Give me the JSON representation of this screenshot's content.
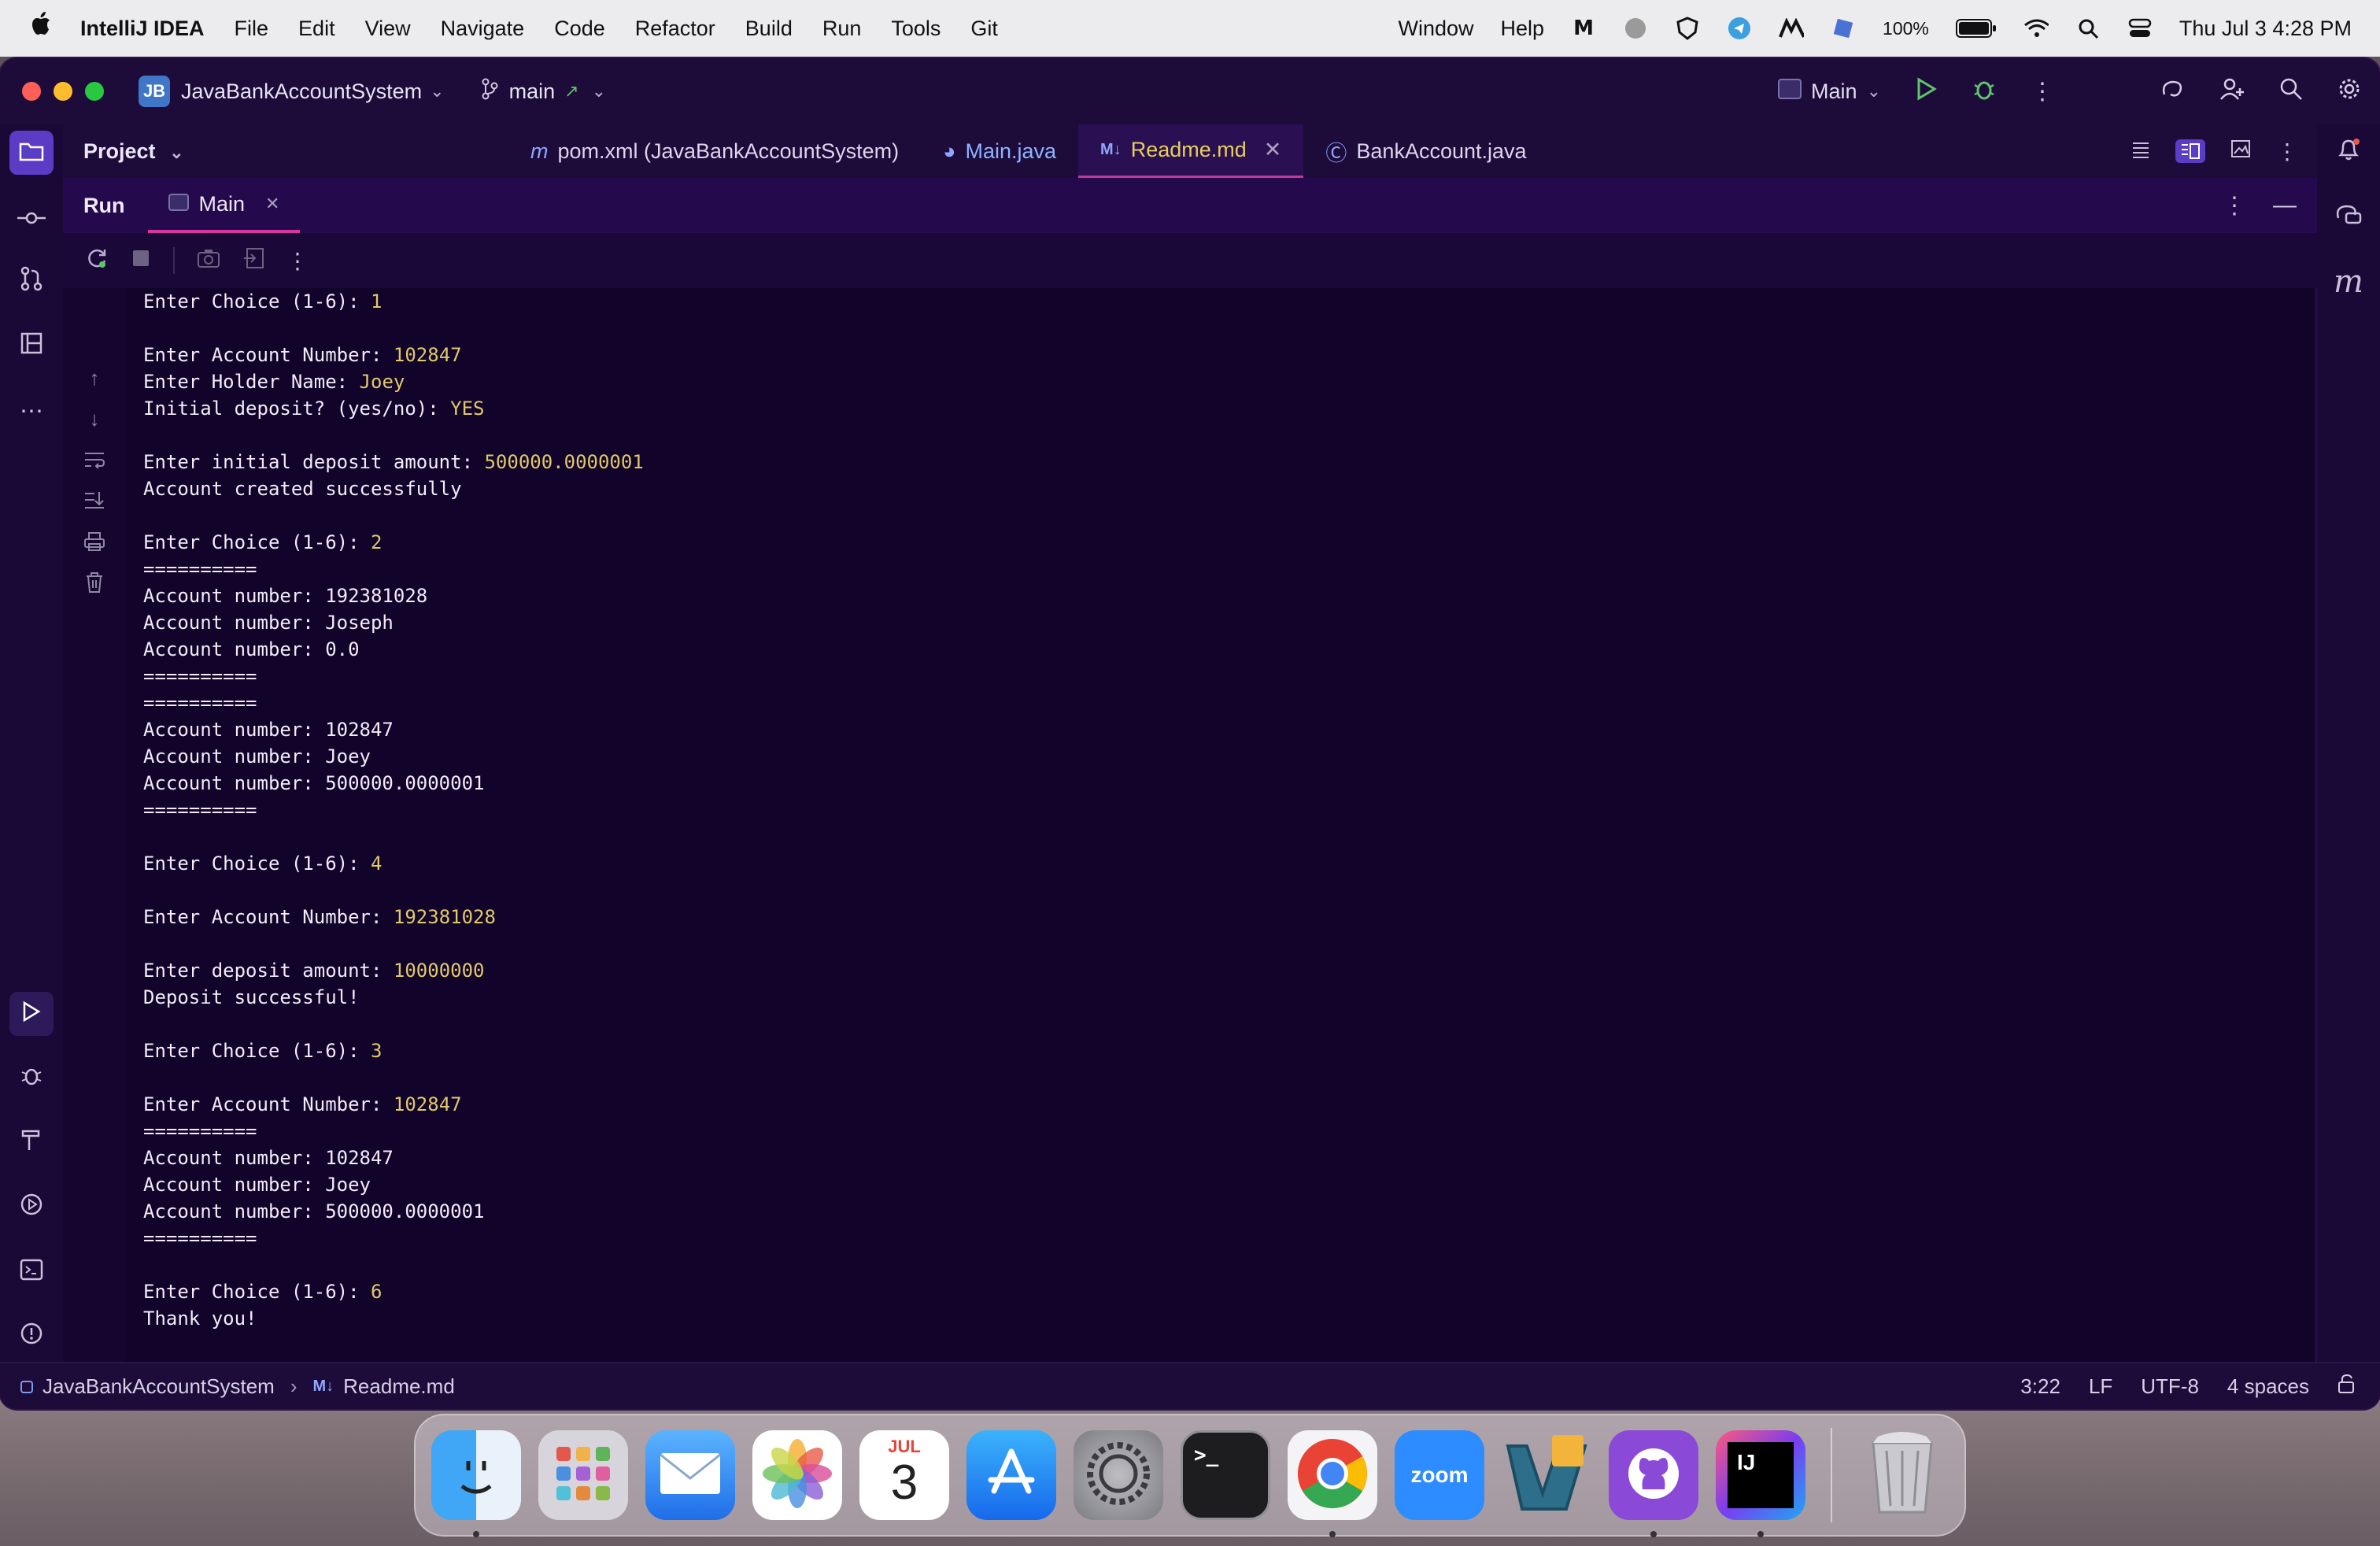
{
  "menubar": {
    "app_name": "IntelliJ IDEA",
    "items": [
      "File",
      "Edit",
      "View",
      "Navigate",
      "Code",
      "Refactor",
      "Build",
      "Run",
      "Tools",
      "Git"
    ],
    "right_items": [
      "Window",
      "Help"
    ],
    "battery": "100%",
    "datetime": "Thu Jul 3  4:28 PM"
  },
  "titlebar": {
    "project_badge": "JB",
    "project_name": "JavaBankAccountSystem",
    "branch": "main",
    "run_config": "Main"
  },
  "project_panel": {
    "label": "Project"
  },
  "editor_tabs": [
    {
      "label": "pom.xml (JavaBankAccountSystem)",
      "icon": "maven-icon"
    },
    {
      "label": "Main.java",
      "icon": "java-class-icon"
    },
    {
      "label": "Readme.md",
      "icon": "markdown-icon"
    },
    {
      "label": "BankAccount.java",
      "icon": "java-class-icon"
    }
  ],
  "run_panel": {
    "title": "Run",
    "tab": "Main"
  },
  "console": {
    "lines": [
      {
        "text": "Enter Choice (1-6): ",
        "input": "1"
      },
      {
        "text": "",
        "input": ""
      },
      {
        "text": "Enter Account Number: ",
        "input": "102847"
      },
      {
        "text": "Enter Holder Name: ",
        "input": "Joey"
      },
      {
        "text": "Initial deposit? (yes/no): ",
        "input": "YES"
      },
      {
        "text": "",
        "input": ""
      },
      {
        "text": "Enter initial deposit amount: ",
        "input": "500000.0000001"
      },
      {
        "text": "Account created successfully",
        "input": ""
      },
      {
        "text": "",
        "input": ""
      },
      {
        "text": "Enter Choice (1-6): ",
        "input": "2"
      },
      {
        "text": "==========",
        "input": ""
      },
      {
        "text": "Account number: 192381028",
        "input": ""
      },
      {
        "text": "Account number: Joseph",
        "input": ""
      },
      {
        "text": "Account number: 0.0",
        "input": ""
      },
      {
        "text": "==========",
        "input": ""
      },
      {
        "text": "==========",
        "input": ""
      },
      {
        "text": "Account number: 102847",
        "input": ""
      },
      {
        "text": "Account number: Joey",
        "input": ""
      },
      {
        "text": "Account number: 500000.0000001",
        "input": ""
      },
      {
        "text": "==========",
        "input": ""
      },
      {
        "text": "",
        "input": ""
      },
      {
        "text": "Enter Choice (1-6): ",
        "input": "4"
      },
      {
        "text": "",
        "input": ""
      },
      {
        "text": "Enter Account Number: ",
        "input": "192381028"
      },
      {
        "text": "",
        "input": ""
      },
      {
        "text": "Enter deposit amount: ",
        "input": "10000000"
      },
      {
        "text": "Deposit successful!",
        "input": ""
      },
      {
        "text": "",
        "input": ""
      },
      {
        "text": "Enter Choice (1-6): ",
        "input": "3"
      },
      {
        "text": "",
        "input": ""
      },
      {
        "text": "Enter Account Number: ",
        "input": "102847"
      },
      {
        "text": "==========",
        "input": ""
      },
      {
        "text": "Account number: 102847",
        "input": ""
      },
      {
        "text": "Account number: Joey",
        "input": ""
      },
      {
        "text": "Account number: 500000.0000001",
        "input": ""
      },
      {
        "text": "==========",
        "input": ""
      },
      {
        "text": "",
        "input": ""
      },
      {
        "text": "Enter Choice (1-6): ",
        "input": "6"
      },
      {
        "text": "Thank you!",
        "input": ""
      }
    ]
  },
  "statusbar": {
    "breadcrumb_project": "JavaBankAccountSystem",
    "breadcrumb_file": "Readme.md",
    "position": "3:22",
    "line_sep": "LF",
    "encoding": "UTF-8",
    "indent": "4 spaces"
  },
  "dock": {
    "apps": [
      "Finder",
      "Launchpad",
      "Mail",
      "Photos",
      "Calendar",
      "App Store",
      "System Settings",
      "Terminal",
      "Chrome",
      "Zoom",
      "Visual Studio Code",
      "GitHub Desktop",
      "IntelliJ IDEA",
      "Trash"
    ],
    "calendar_month": "JUL",
    "calendar_day": "3",
    "zoom_label": "zoom",
    "terminal_label": ">_",
    "intellij_label": "IJ"
  },
  "colors": {
    "ide_bg": "#17062e",
    "console_bg": "#11032a",
    "input_text": "#e1c96a",
    "active_tab_accent": "#c0399b",
    "run_tab_underline": "#d8369c",
    "tool_active": "#5b3cc4"
  }
}
